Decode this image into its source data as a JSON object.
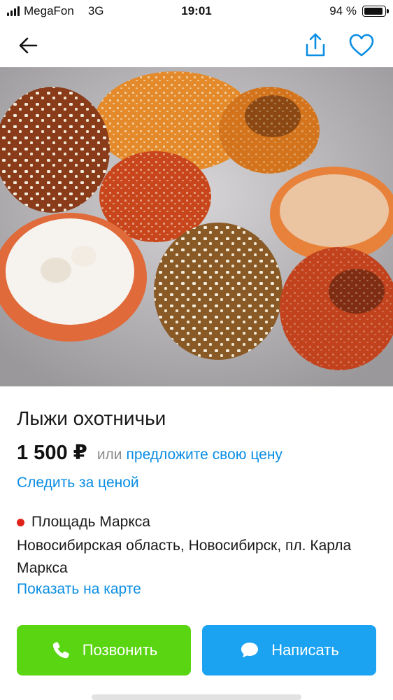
{
  "status_bar": {
    "carrier": "MegaFon",
    "network": "3G",
    "time": "19:01",
    "battery_text": "94 %",
    "battery_level": 0.94
  },
  "nav": {
    "back_icon": "arrow-left-icon",
    "share_icon": "share-upload-icon",
    "favorite_icon": "heart-outline-icon",
    "accent_color": "#0a8ee3"
  },
  "listing": {
    "title": "Лыжи охотничьи",
    "price": "1 500 ₽",
    "price_or": "или",
    "offer_price_link": "предложите свою цену",
    "follow_price_link": "Следить за ценой",
    "metro_station": "Площадь Маркса",
    "metro_color": "#e1221b",
    "address": "Новосибирская область, Новосибирск, пл. Карла Маркса",
    "show_on_map_link": "Показать на карте"
  },
  "actions": {
    "call_label": "Позвонить",
    "call_color": "#5ad512",
    "write_label": "Написать",
    "write_color": "#1ba3f2"
  }
}
